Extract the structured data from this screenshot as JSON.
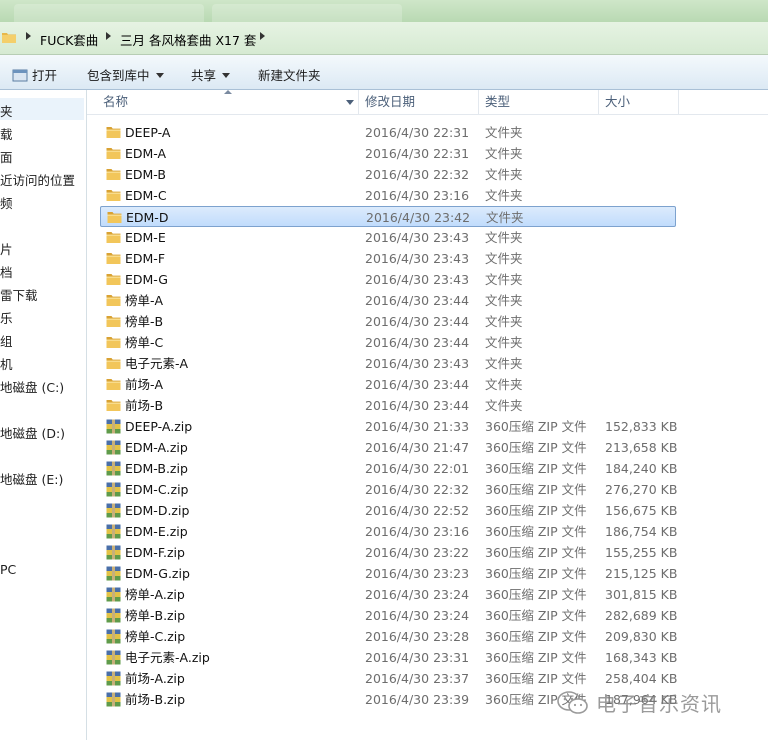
{
  "address": {
    "crumbs": [
      "FUCK套曲",
      "三月 各风格套曲 X17 套"
    ]
  },
  "toolbar": {
    "open": "打开",
    "include": "包含到库中",
    "share": "共享",
    "new_folder": "新建文件夹"
  },
  "nav": {
    "items": [
      "夹",
      "载",
      "面",
      "近访问的位置",
      "频",
      "片",
      "档",
      "雷下载",
      "乐",
      "组",
      "机",
      "地磁盘 (C:)",
      "地磁盘 (D:)",
      "地磁盘 (E:)",
      "PC"
    ]
  },
  "columns": {
    "name": "名称",
    "date": "修改日期",
    "type": "类型",
    "size": "大小"
  },
  "files": [
    {
      "name": "DEEP-A",
      "date": "2016/4/30 22:31",
      "type": "文件夹",
      "size": "",
      "kind": "folder"
    },
    {
      "name": "EDM-A",
      "date": "2016/4/30 22:31",
      "type": "文件夹",
      "size": "",
      "kind": "folder"
    },
    {
      "name": "EDM-B",
      "date": "2016/4/30 22:32",
      "type": "文件夹",
      "size": "",
      "kind": "folder"
    },
    {
      "name": "EDM-C",
      "date": "2016/4/30 23:16",
      "type": "文件夹",
      "size": "",
      "kind": "folder"
    },
    {
      "name": "EDM-D",
      "date": "2016/4/30 23:42",
      "type": "文件夹",
      "size": "",
      "kind": "folder",
      "selected": true
    },
    {
      "name": "EDM-E",
      "date": "2016/4/30 23:43",
      "type": "文件夹",
      "size": "",
      "kind": "folder"
    },
    {
      "name": "EDM-F",
      "date": "2016/4/30 23:43",
      "type": "文件夹",
      "size": "",
      "kind": "folder"
    },
    {
      "name": "EDM-G",
      "date": "2016/4/30 23:43",
      "type": "文件夹",
      "size": "",
      "kind": "folder"
    },
    {
      "name": "榜单-A",
      "date": "2016/4/30 23:44",
      "type": "文件夹",
      "size": "",
      "kind": "folder"
    },
    {
      "name": "榜单-B",
      "date": "2016/4/30 23:44",
      "type": "文件夹",
      "size": "",
      "kind": "folder"
    },
    {
      "name": "榜单-C",
      "date": "2016/4/30 23:44",
      "type": "文件夹",
      "size": "",
      "kind": "folder"
    },
    {
      "name": "电子元素-A",
      "date": "2016/4/30 23:43",
      "type": "文件夹",
      "size": "",
      "kind": "folder"
    },
    {
      "name": "前场-A",
      "date": "2016/4/30 23:44",
      "type": "文件夹",
      "size": "",
      "kind": "folder"
    },
    {
      "name": "前场-B",
      "date": "2016/4/30 23:44",
      "type": "文件夹",
      "size": "",
      "kind": "folder"
    },
    {
      "name": "DEEP-A.zip",
      "date": "2016/4/30 21:33",
      "type": "360压缩 ZIP 文件",
      "size": "152,833 KB",
      "kind": "zip"
    },
    {
      "name": "EDM-A.zip",
      "date": "2016/4/30 21:47",
      "type": "360压缩 ZIP 文件",
      "size": "213,658 KB",
      "kind": "zip"
    },
    {
      "name": "EDM-B.zip",
      "date": "2016/4/30 22:01",
      "type": "360压缩 ZIP 文件",
      "size": "184,240 KB",
      "kind": "zip"
    },
    {
      "name": "EDM-C.zip",
      "date": "2016/4/30 22:32",
      "type": "360压缩 ZIP 文件",
      "size": "276,270 KB",
      "kind": "zip"
    },
    {
      "name": "EDM-D.zip",
      "date": "2016/4/30 22:52",
      "type": "360压缩 ZIP 文件",
      "size": "156,675 KB",
      "kind": "zip"
    },
    {
      "name": "EDM-E.zip",
      "date": "2016/4/30 23:16",
      "type": "360压缩 ZIP 文件",
      "size": "186,754 KB",
      "kind": "zip"
    },
    {
      "name": "EDM-F.zip",
      "date": "2016/4/30 23:22",
      "type": "360压缩 ZIP 文件",
      "size": "155,255 KB",
      "kind": "zip"
    },
    {
      "name": "EDM-G.zip",
      "date": "2016/4/30 23:23",
      "type": "360压缩 ZIP 文件",
      "size": "215,125 KB",
      "kind": "zip"
    },
    {
      "name": "榜单-A.zip",
      "date": "2016/4/30 23:24",
      "type": "360压缩 ZIP 文件",
      "size": "301,815 KB",
      "kind": "zip"
    },
    {
      "name": "榜单-B.zip",
      "date": "2016/4/30 23:24",
      "type": "360压缩 ZIP 文件",
      "size": "282,689 KB",
      "kind": "zip"
    },
    {
      "name": "榜单-C.zip",
      "date": "2016/4/30 23:28",
      "type": "360压缩 ZIP 文件",
      "size": "209,830 KB",
      "kind": "zip"
    },
    {
      "name": "电子元素-A.zip",
      "date": "2016/4/30 23:31",
      "type": "360压缩 ZIP 文件",
      "size": "168,343 KB",
      "kind": "zip"
    },
    {
      "name": "前场-A.zip",
      "date": "2016/4/30 23:37",
      "type": "360压缩 ZIP 文件",
      "size": "258,404 KB",
      "kind": "zip"
    },
    {
      "name": "前场-B.zip",
      "date": "2016/4/30 23:39",
      "type": "360压缩 ZIP 文件",
      "size": "187,964 KB",
      "kind": "zip"
    }
  ],
  "watermark": {
    "text": "电子音乐资讯"
  },
  "colors": {
    "selection": "#cce3fb",
    "folder": "#e8b84a",
    "address_bar": "#d6ead2"
  }
}
